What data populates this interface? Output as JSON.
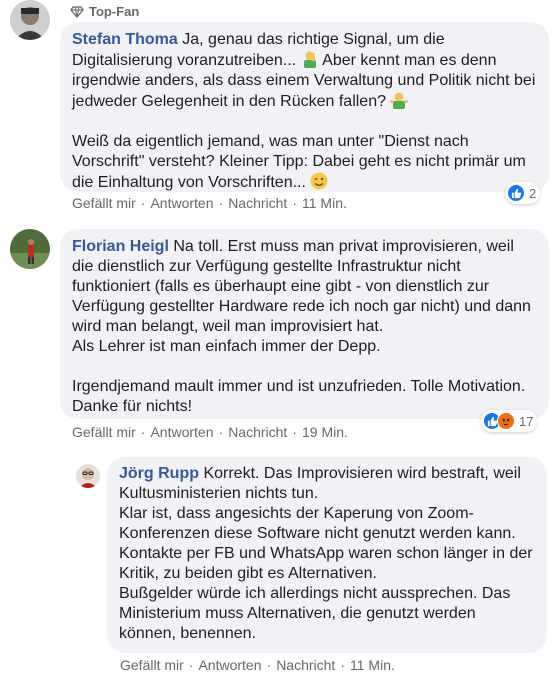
{
  "comment1": {
    "badge": "Top-Fan",
    "author": "Stefan Thoma",
    "para1_a": "Ja, genau das richtige Signal, um die Digitalisierung voranzutreiben...",
    "para1_b": "Aber kennt man es denn irgendwie anders, als dass einem Verwaltung und Politik nicht bei jedweder Gelegenheit in den Rücken fallen?",
    "para2": "Weiß da eigentlich jemand, was man unter \"Dienst nach Vorschrift\" versteht? Kleiner Tipp: Dabei geht es nicht primär um die Einhaltung von Vorschriften...",
    "reaction_count": "2",
    "actions": {
      "like": "Gefällt mir",
      "reply": "Antworten",
      "message": "Nachricht",
      "time": "11 Min."
    }
  },
  "comment2": {
    "author": "Florian Heigl",
    "para1": "Na toll. Erst muss man privat improvisieren, weil die dienstlich zur Verfügung gestellte Infrastruktur nicht funktioniert (falls es überhaupt eine gibt - von dienstlich zur Verfügung gestellter Hardware rede ich noch gar nicht) und dann wird man belangt, weil man improvisiert hat.",
    "para1_line2": "Als Lehrer ist man einfach immer der Depp.",
    "para2": "Irgendjemand mault immer und ist unzufrieden. Tolle Motivation. Danke für nichts!",
    "reaction_count": "17",
    "actions": {
      "like": "Gefällt mir",
      "reply": "Antworten",
      "message": "Nachricht",
      "time": "19 Min."
    }
  },
  "reply1": {
    "author": "Jörg Rupp",
    "line1": "Korrekt. Das Improvisieren wird bestraft, weil Kultusministerien nichts tun.",
    "line2": "Klar ist, dass angesichts der Kaperung von Zoom-Konferenzen diese Software nicht genutzt werden kann.",
    "line3": "Kontakte per FB und WhatsApp waren schon länger in der Kritik, zu beiden gibt es Alternativen.",
    "line4": "Bußgelder würde ich allerdings nicht aussprechen. Das Ministerium muss Alternativen, die genutzt werden können, benennen.",
    "actions": {
      "like": "Gefällt mir",
      "reply": "Antworten",
      "message": "Nachricht",
      "time": "11 Min."
    }
  },
  "colors": {
    "author_link": "#385898",
    "bubble_bg": "#f0f2f5",
    "like_blue": "#1877f2",
    "angry_orange": "#e9710f",
    "muted_text": "#65676b"
  },
  "icons": {
    "badge": "diamond-icon",
    "face_palm_emoji": "man-facepalming-emoji",
    "shrug_emoji": "man-shrugging-emoji",
    "wink_emoji": "winking-face-emoji",
    "like_reaction": "thumbs-up-icon",
    "angry_reaction": "angry-face-icon"
  }
}
